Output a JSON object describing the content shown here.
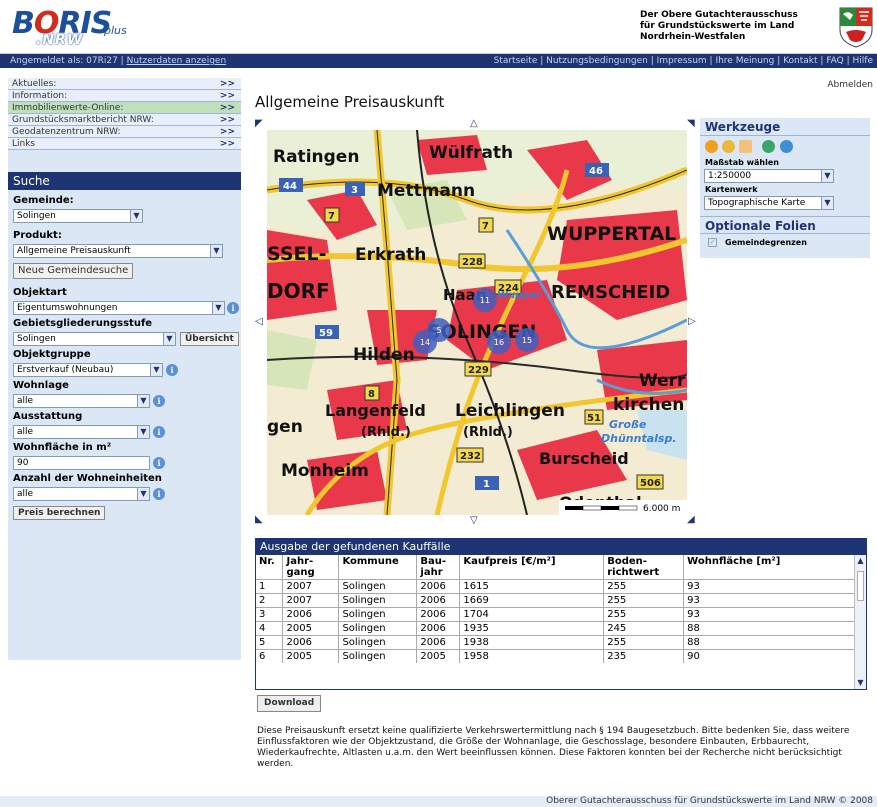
{
  "header": {
    "logo_boris_pre": "B",
    "logo_boris_o": "O",
    "logo_boris_post": "RIS",
    "logo_plus": "plus",
    "logo_nrw": ".NRW",
    "org_line1": "Der Obere Gutachterausschuss",
    "org_line2": "für Grundstückswerte im Land",
    "org_line3": "Nordrhein-Westfalen"
  },
  "topbar": {
    "logged_in": "Angemeldet als: 07Ri27 |",
    "user_data_link": "Nutzerdaten anzeigen",
    "links": [
      "Startseite",
      "Nutzungsbedingungen",
      "Impressum",
      "Ihre Meinung",
      "Kontakt",
      "FAQ",
      "Hilfe"
    ]
  },
  "leftnav": [
    {
      "label": "Aktuelles:",
      "arrows": ">>"
    },
    {
      "label": "Information:",
      "arrows": ">>"
    },
    {
      "label": "Immobilienwerte-Online:",
      "arrows": ">>"
    },
    {
      "label": "Grundstücksmarktbericht NRW:",
      "arrows": ">>"
    },
    {
      "label": "Geodatenzentrum NRW:",
      "arrows": ">>"
    },
    {
      "label": "Links",
      "arrows": ">>"
    }
  ],
  "search": {
    "title": "Suche",
    "gemeinde_label": "Gemeinde:",
    "gemeinde_value": "Solingen",
    "produkt_label": "Produkt:",
    "produkt_value": "Allgemeine Preisauskunft",
    "neue_gemeindesuche": "Neue Gemeindesuche",
    "objektart_label": "Objektart",
    "objektart_value": "Eigentumswohnungen",
    "gebiet_label": "Gebietsgliederungsstufe",
    "gebiet_value": "Solingen",
    "uebersicht": "Übersicht",
    "objektgruppe_label": "Objektgruppe",
    "objektgruppe_value": "Erstverkauf (Neubau)",
    "wohnlage_label": "Wohnlage",
    "wohnlage_value": "alle",
    "ausstattung_label": "Ausstattung",
    "ausstattung_value": "alle",
    "wohnflaeche_label": "Wohnfläche in m²",
    "wohnflaeche_value": "90",
    "anzahl_label": "Anzahl der Wohneinheiten",
    "anzahl_value": "alle",
    "preis_button": "Preis berechnen"
  },
  "main": {
    "abmelden": "Abmelden",
    "title": "Allgemeine Preisauskunft"
  },
  "map": {
    "places": [
      "Ratingen",
      "Wülfrath",
      "Mettmann",
      "SSEL-",
      "Erkrath",
      "WUPPERTAL",
      "DORF",
      "Haan",
      "REMSCHEID",
      "SOLINGEN",
      "Hilden",
      "Werr",
      "kirchen",
      "Langenfeld",
      "(Rhld.)",
      "Leichlingen",
      "(Rhld.)",
      "gen",
      "Monheim",
      "Burscheid",
      "Odenthal",
      "Wupper",
      "Große",
      "Dhünntalsp."
    ],
    "road_signs": [
      "44",
      "3",
      "46",
      "7",
      "7",
      "228",
      "224",
      "59",
      "229",
      "8",
      "51",
      "232",
      "1",
      "506"
    ],
    "markers": [
      "14",
      "5",
      "11",
      "16",
      "15"
    ],
    "scale_text": "6.000 m",
    "compass": {
      "n": "N",
      "s": "S",
      "w": "W",
      "e": "E"
    }
  },
  "tools": {
    "title": "Werkzeuge",
    "scale_label": "Maßstab wählen",
    "scale_value": "1:250000",
    "map_label": "Kartenwerk",
    "map_value": "Topographische Karte",
    "optional_title": "Optionale Folien",
    "option_gemeindegrenzen": "Gemeindegrenzen"
  },
  "results": {
    "title": "Ausgabe der gefundenen Kauffälle",
    "columns": [
      "Nr.",
      "Jahr-\ngang",
      "Kommune",
      "Bau-\njahr",
      "Kaufpreis [€/m²]",
      "Boden-\nrichtwert",
      "Wohnfläche [m²]"
    ],
    "rows": [
      [
        "1",
        "2007",
        "Solingen",
        "2006",
        "1615",
        "255",
        "93"
      ],
      [
        "2",
        "2007",
        "Solingen",
        "2006",
        "1669",
        "255",
        "93"
      ],
      [
        "3",
        "2006",
        "Solingen",
        "2006",
        "1704",
        "255",
        "93"
      ],
      [
        "4",
        "2005",
        "Solingen",
        "2006",
        "1935",
        "245",
        "88"
      ],
      [
        "5",
        "2006",
        "Solingen",
        "2006",
        "1938",
        "255",
        "88"
      ],
      [
        "6",
        "2005",
        "Solingen",
        "2005",
        "1958",
        "235",
        "90"
      ]
    ],
    "download": "Download"
  },
  "disclaimer": "Diese Preisauskunft ersetzt keine qualifizierte Verkehrswertermittlung nach § 194 Baugesetzbuch. Bitte bedenken Sie, dass weitere Einflussfaktoren wie der Objektzustand, die Größe der Wohnanlage, die Geschosslage, besondere Einbauten, Erbbaurecht, Wiederkaufrechte, Altlasten u.a.m. den Wert beeinflussen können. Diese Faktoren konnten bei der Recherche nicht berücksichtigt werden.",
  "footer": "Oberer Gutachterausschuss für Grundstückswerte im Land NRW © 2008"
}
